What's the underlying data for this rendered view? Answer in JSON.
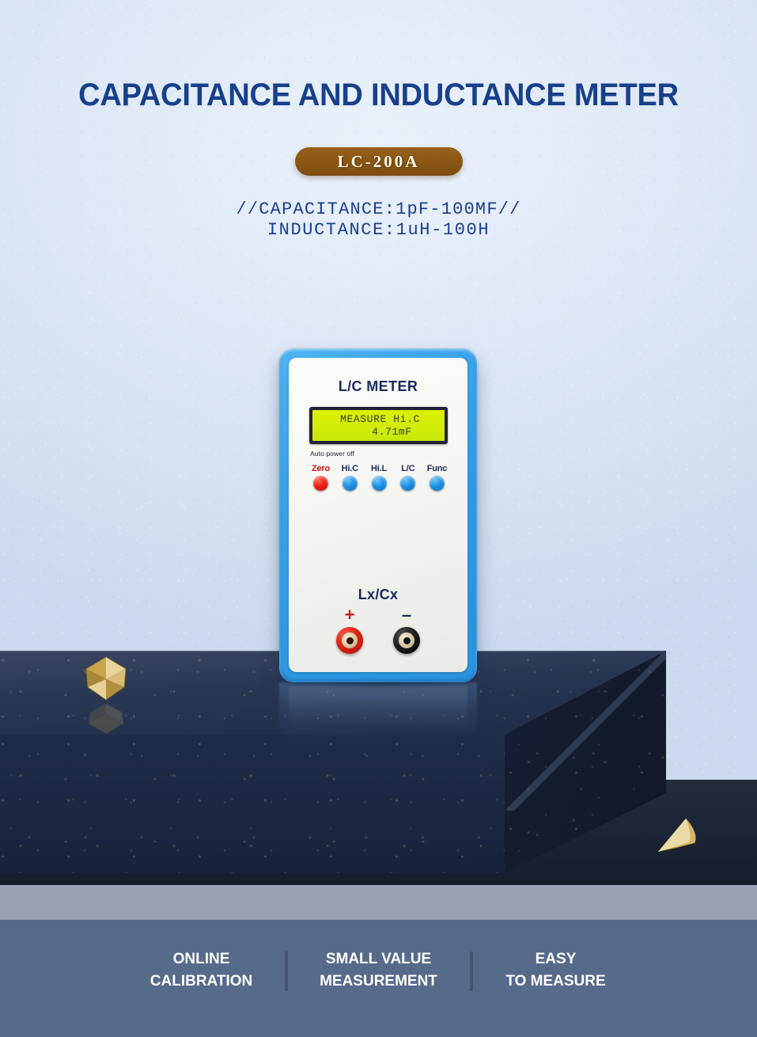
{
  "header": {
    "headline": "CAPACITANCE AND INDUCTANCE METER",
    "model_badge": "LC-200A",
    "spec_line_1": "//CAPACITANCE:1pF-100MF//",
    "spec_line_2": "INDUCTANCE:1uH-100H"
  },
  "device": {
    "brand_label": "L/C METER",
    "lcd": {
      "line_1": "MEASURE Hi.C",
      "line_2": "4.71mF"
    },
    "auto_power_off_label": "Auto power off",
    "buttons": [
      {
        "label": "Zero",
        "color": "#ef2015",
        "label_color": "#cf1616"
      },
      {
        "label": "Hi.C",
        "color": "#1d8fe0",
        "label_color": "#1b2a5c"
      },
      {
        "label": "Hi.L",
        "color": "#1d8fe0",
        "label_color": "#1b2a5c"
      },
      {
        "label": "L/C",
        "color": "#1d8fe0",
        "label_color": "#1b2a5c"
      },
      {
        "label": "Func",
        "color": "#1d8fe0",
        "label_color": "#1b2a5c"
      }
    ],
    "terminals": {
      "group_label": "Lx/Cx",
      "positive_symbol": "+",
      "negative_symbol": "–"
    }
  },
  "footer": {
    "features": [
      {
        "line_1": "ONLINE",
        "line_2": "CALIBRATION"
      },
      {
        "line_1": "SMALL VALUE",
        "line_2": "MEASUREMENT"
      },
      {
        "line_1": "EASY",
        "line_2": "TO MEASURE"
      }
    ]
  },
  "colors": {
    "background": "#dde7f5",
    "headline": "#17408b",
    "badge": "#8a5613",
    "device_bezel": "#2e9ae6",
    "device_face": "#f5f5f2",
    "lcd_screen": "#d4ee07",
    "pedestal": "#1e2b45",
    "footer": "#566a8a",
    "band_gray": "#99a1b3",
    "gold": "#c9a44c"
  }
}
